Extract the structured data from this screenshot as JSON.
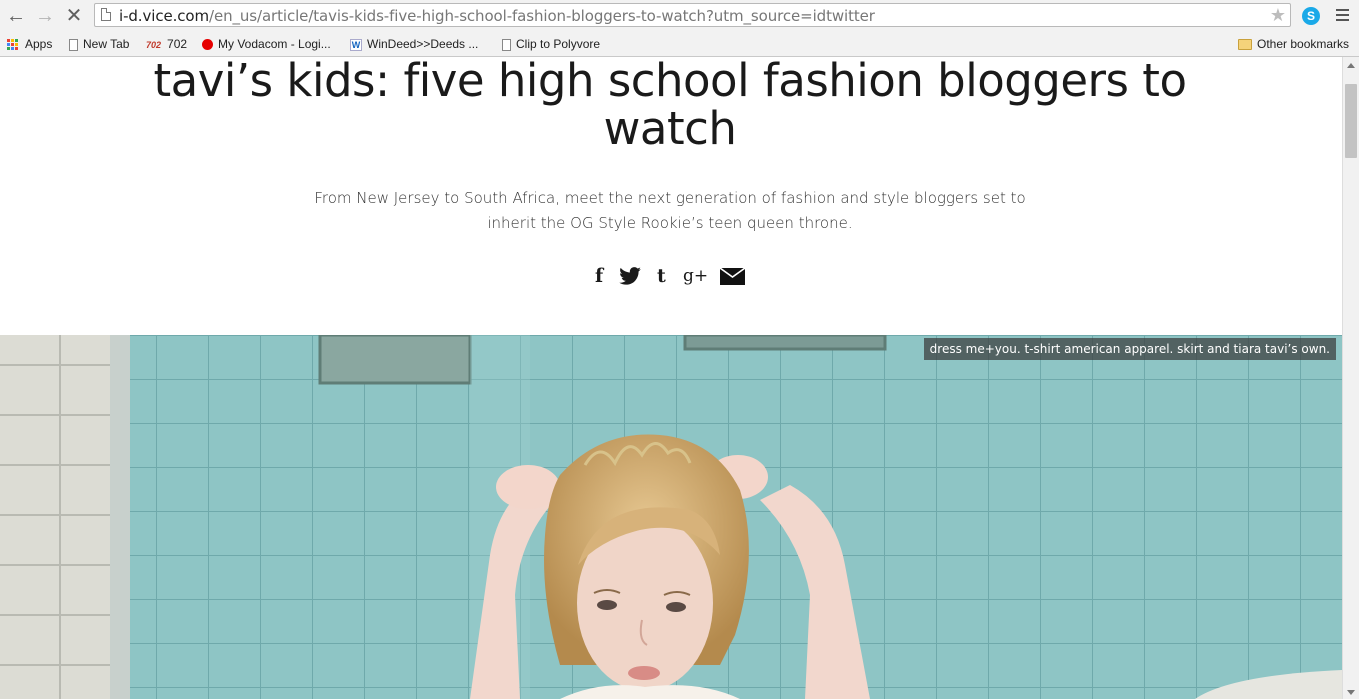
{
  "browser": {
    "url_host": "i-d.vice.com",
    "url_path": "/en_us/article/tavis-kids-five-high-school-fashion-bloggers-to-watch?utm_source=idtwitter",
    "bookmarks": {
      "apps": "Apps",
      "new_tab": "New Tab",
      "b702_icon": "702",
      "b702": "702",
      "vodacom": "My Vodacom - Logi...",
      "windeed_icon": "W",
      "windeed": "WinDeed>>Deeds ...",
      "polyvore": "Clip to Polyvore",
      "other": "Other bookmarks"
    },
    "skype_icon": "S"
  },
  "article": {
    "title": "tavi’s kids: five high school fashion bloggers to watch",
    "dek": "From New Jersey to South Africa, meet the next generation of fashion and style bloggers set to inherit the OG Style Rookie’s teen queen throne.",
    "share": {
      "facebook": "f",
      "tumblr": "t",
      "gplus": "g+"
    },
    "photo_caption": "dress me+you. t-shirt american apparel. skirt and tiara tavi’s own."
  },
  "colors": {
    "tile_blue": "#8ec5c5",
    "chrome_bg": "#f2f2f2"
  }
}
